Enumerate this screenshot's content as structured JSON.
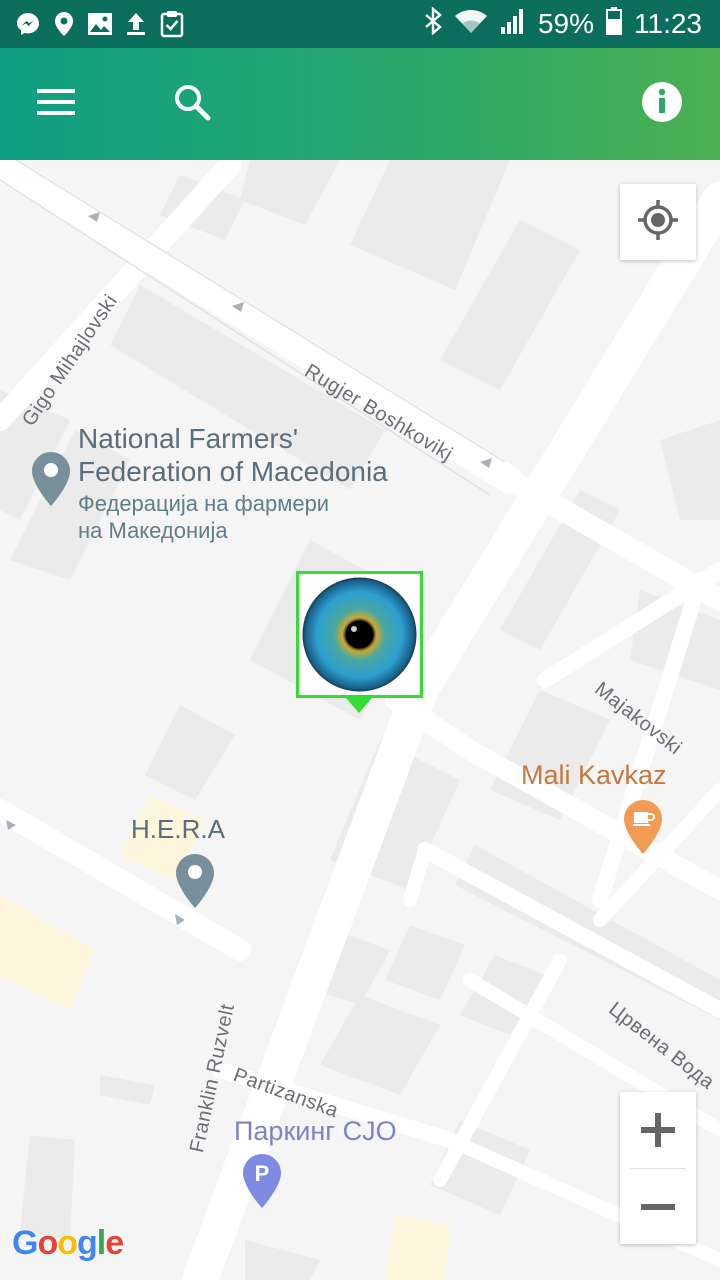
{
  "status_bar": {
    "battery": "59%",
    "time": "11:23",
    "left_icons": [
      "messenger-icon",
      "location-pin-icon",
      "image-icon",
      "upload-icon",
      "clipboard-check-icon"
    ],
    "right_icons": [
      "bluetooth-icon",
      "wifi-icon",
      "signal-icon",
      "battery-icon"
    ]
  },
  "app_bar": {
    "icons": [
      "menu-icon",
      "search-icon",
      "info-icon"
    ],
    "color_start": "#0f9f83",
    "color_end": "#4caf50"
  },
  "map": {
    "streets": {
      "rugjer": "Rugjer Boshkovikj",
      "gigo": "Gigo Mihajlovski",
      "majakovski": "Majakovski",
      "crvena": "Црвена Вода",
      "franklin": "Franklin Ruzvelt",
      "partizanska": "Partizanska"
    },
    "pois": {
      "farmers_title_1": "National Farmers'",
      "farmers_title_2": "Federation of Macedonia",
      "farmers_sub_1": "Федерација на фармери",
      "farmers_sub_2": "на Македонија",
      "hera": "H.E.R.A",
      "mali_kavkaz": "Mali Kavkaz",
      "parking": "Паркинг CJO"
    },
    "marker_color": "#33dd33",
    "attribution": [
      "G",
      "o",
      "o",
      "g",
      "l",
      "e"
    ]
  },
  "controls": {
    "my_location": "my-location-icon",
    "zoom_in": "+",
    "zoom_out": "−"
  }
}
